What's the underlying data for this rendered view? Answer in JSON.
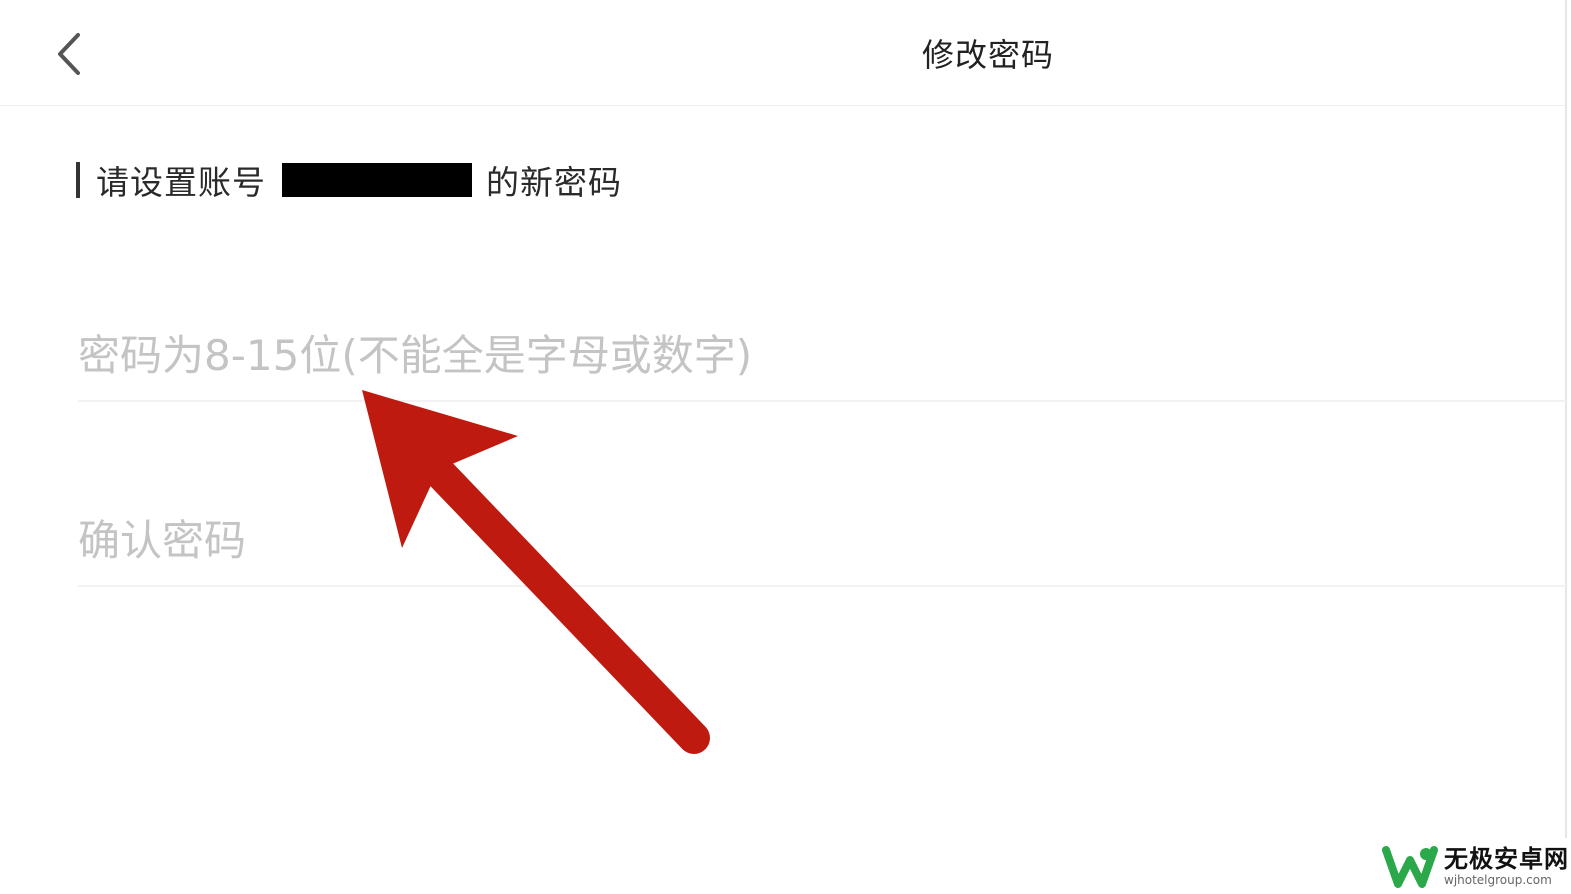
{
  "header": {
    "title": "修改密码",
    "back_icon": "chevron-left-icon"
  },
  "section": {
    "heading_prefix": "请设置账号",
    "heading_suffix": "的新密码"
  },
  "form": {
    "password_placeholder": "密码为8-15位(不能全是字母或数字)",
    "password_value": "",
    "confirm_placeholder": "确认密码",
    "confirm_value": ""
  },
  "annotation": {
    "arrow_color": "#BE1A10"
  },
  "watermark": {
    "name": "无极安卓网",
    "url": "wjhotelgroup.com",
    "logo_color": "#2BA84A"
  }
}
